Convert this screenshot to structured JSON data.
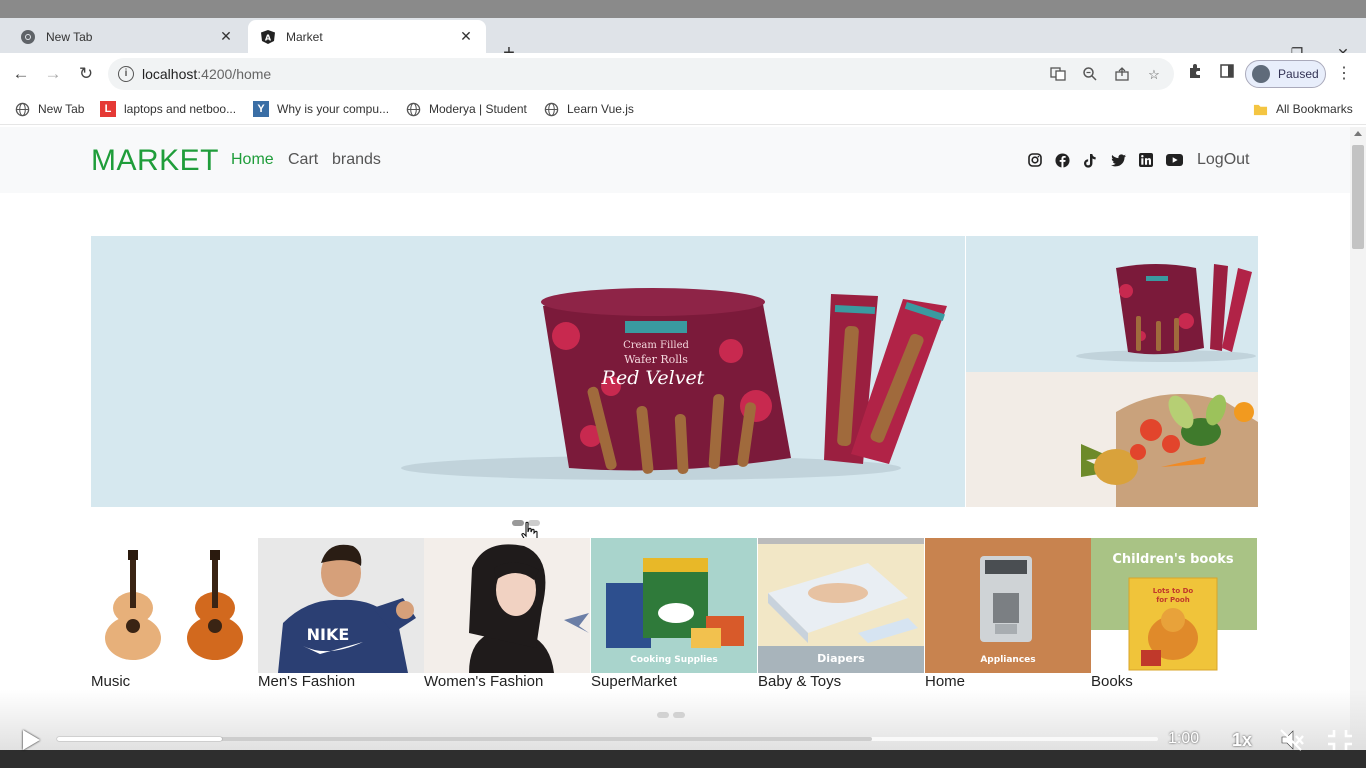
{
  "browser": {
    "tabs": [
      {
        "title": "New Tab",
        "icon": "chrome-icon",
        "active": false
      },
      {
        "title": "Market",
        "icon": "angular-icon",
        "active": true
      }
    ],
    "address": {
      "host": "localhost",
      "rest": ":4200/home"
    },
    "profile_label": "Paused",
    "bookmarks": [
      {
        "label": "New Tab",
        "icon": "globe-icon"
      },
      {
        "label": "laptops and netboo...",
        "icon": "l-brand-icon"
      },
      {
        "label": "Why is your compu...",
        "icon": "y-brand-icon"
      },
      {
        "label": "Moderya | Student",
        "icon": "globe-icon"
      },
      {
        "label": "Learn Vue.js",
        "icon": "globe-icon"
      }
    ],
    "all_bookmarks": "All Bookmarks"
  },
  "site": {
    "brand": "MARKET",
    "nav": [
      "Home",
      "Cart",
      "brands"
    ],
    "logout": "LogOut",
    "social_icons": [
      "instagram-icon",
      "facebook-icon",
      "tiktok-icon",
      "twitter-icon",
      "linkedin-icon",
      "youtube-icon"
    ],
    "accent_color": "#1f9d3a",
    "hero": {
      "product_lines": [
        "Cream Filled",
        "Wafer Rolls",
        "Red Velvet"
      ]
    },
    "categories": [
      {
        "label": "Music"
      },
      {
        "label": "Men's Fashion",
        "image_text": "NIKE"
      },
      {
        "label": "Women's Fashion"
      },
      {
        "label": "SuperMarket",
        "image_text": "Cooking Supplies"
      },
      {
        "label": "Baby & Toys",
        "image_text": "Diapers"
      },
      {
        "label": "Home",
        "image_text": "Appliances"
      },
      {
        "label": "Books",
        "image_text": "Children's books"
      }
    ]
  },
  "video": {
    "time": "1:00",
    "speed": "1x",
    "played_fraction": 0.15,
    "buffered_fraction": 0.74
  }
}
